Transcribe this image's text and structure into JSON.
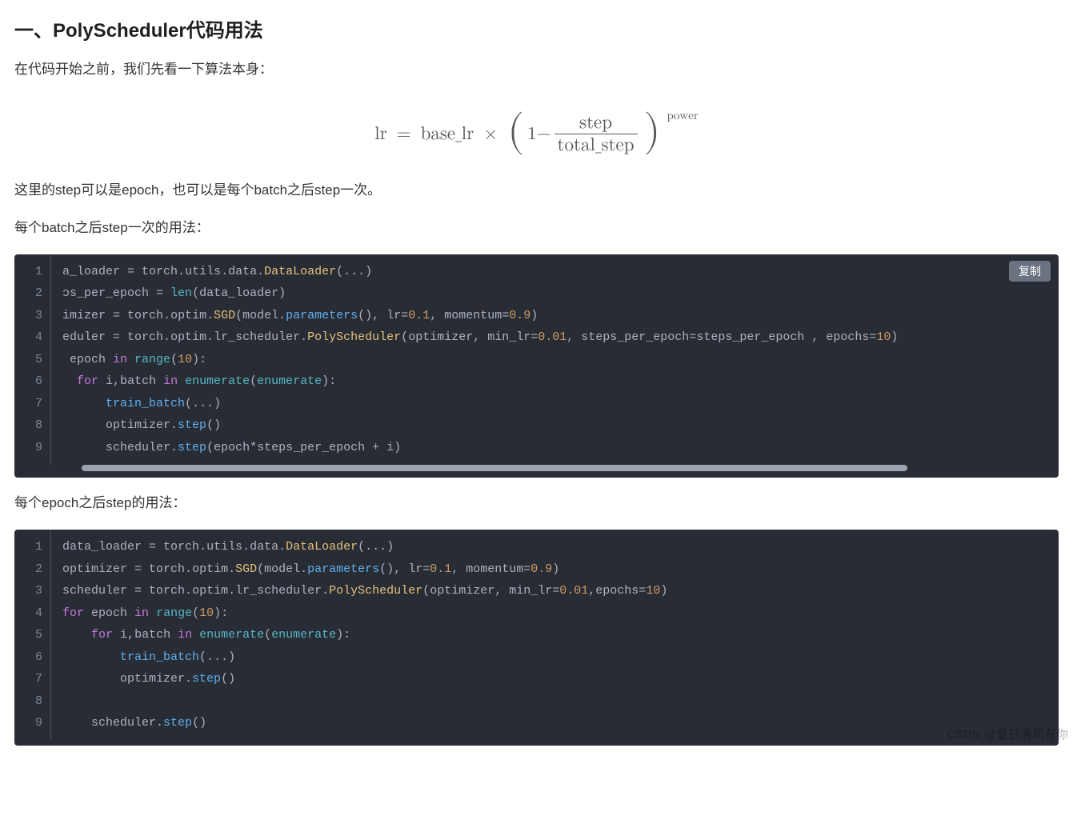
{
  "heading": "一、PolyScheduler代码用法",
  "intro": "在代码开始之前，我们先看一下算法本身：",
  "formula": {
    "lhs_lr": "lr",
    "eq": "=",
    "base_lr": "base_lr",
    "times": "×",
    "one": "1",
    "minus": "−",
    "frac_num": "step",
    "frac_den": "total_step",
    "power": "power"
  },
  "para_step_desc": "这里的step可以是epoch，也可以是每个batch之后step一次。",
  "para_batch_usage": "每个batch之后step一次的用法：",
  "copy_label": "复制",
  "code1": {
    "lines": [
      [
        [
          "id",
          "a_loader"
        ],
        [
          "op",
          " = "
        ],
        [
          "id",
          "torch"
        ],
        [
          "pun",
          "."
        ],
        [
          "id",
          "utils"
        ],
        [
          "pun",
          "."
        ],
        [
          "id",
          "data"
        ],
        [
          "pun",
          "."
        ],
        [
          "cls",
          "DataLoader"
        ],
        [
          "pun",
          "("
        ],
        [
          "pun",
          "..."
        ],
        [
          "pun",
          ")"
        ]
      ],
      [
        [
          "id",
          "ɔs_per_epoch"
        ],
        [
          "op",
          " = "
        ],
        [
          "bi",
          "len"
        ],
        [
          "pun",
          "("
        ],
        [
          "id",
          "data_loader"
        ],
        [
          "pun",
          ")"
        ]
      ],
      [
        [
          "id",
          "imizer"
        ],
        [
          "op",
          " = "
        ],
        [
          "id",
          "torch"
        ],
        [
          "pun",
          "."
        ],
        [
          "id",
          "optim"
        ],
        [
          "pun",
          "."
        ],
        [
          "cls",
          "SGD"
        ],
        [
          "pun",
          "("
        ],
        [
          "id",
          "model"
        ],
        [
          "pun",
          "."
        ],
        [
          "fn",
          "parameters"
        ],
        [
          "pun",
          "(), "
        ],
        [
          "id",
          "lr"
        ],
        [
          "op",
          "="
        ],
        [
          "num",
          "0.1"
        ],
        [
          "pun",
          ", "
        ],
        [
          "id",
          "momentum"
        ],
        [
          "op",
          "="
        ],
        [
          "num",
          "0.9"
        ],
        [
          "pun",
          ")"
        ]
      ],
      [
        [
          "id",
          "eduler"
        ],
        [
          "op",
          " = "
        ],
        [
          "id",
          "torch"
        ],
        [
          "pun",
          "."
        ],
        [
          "id",
          "optim"
        ],
        [
          "pun",
          "."
        ],
        [
          "id",
          "lr_scheduler"
        ],
        [
          "pun",
          "."
        ],
        [
          "cls",
          "PolyScheduler"
        ],
        [
          "pun",
          "("
        ],
        [
          "id",
          "optimizer"
        ],
        [
          "pun",
          ", "
        ],
        [
          "id",
          "min_lr"
        ],
        [
          "op",
          "="
        ],
        [
          "num",
          "0.01"
        ],
        [
          "pun",
          ", "
        ],
        [
          "id",
          "steps_per_epoch"
        ],
        [
          "op",
          "="
        ],
        [
          "id",
          "steps_per_epoch "
        ],
        [
          "pun",
          ", "
        ],
        [
          "id",
          "epochs"
        ],
        [
          "op",
          "="
        ],
        [
          "num",
          "10"
        ],
        [
          "pun",
          ")"
        ]
      ],
      [
        [
          "id",
          " epoch "
        ],
        [
          "kw",
          "in"
        ],
        [
          "id",
          " "
        ],
        [
          "bi",
          "range"
        ],
        [
          "pun",
          "("
        ],
        [
          "num",
          "10"
        ],
        [
          "pun",
          "):"
        ]
      ],
      [
        [
          "id",
          "  "
        ],
        [
          "kw",
          "for"
        ],
        [
          "id",
          " i"
        ],
        [
          "pun",
          ","
        ],
        [
          "id",
          "batch "
        ],
        [
          "kw",
          "in"
        ],
        [
          "id",
          " "
        ],
        [
          "bi",
          "enumerate"
        ],
        [
          "pun",
          "("
        ],
        [
          "bi",
          "enumerate"
        ],
        [
          "pun",
          "):"
        ]
      ],
      [
        [
          "id",
          "      "
        ],
        [
          "fn",
          "train_batch"
        ],
        [
          "pun",
          "("
        ],
        [
          "pun",
          "..."
        ],
        [
          "pun",
          ")"
        ]
      ],
      [
        [
          "id",
          "      optimizer"
        ],
        [
          "pun",
          "."
        ],
        [
          "fn",
          "step"
        ],
        [
          "pun",
          "()"
        ]
      ],
      [
        [
          "id",
          "      scheduler"
        ],
        [
          "pun",
          "."
        ],
        [
          "fn",
          "step"
        ],
        [
          "pun",
          "("
        ],
        [
          "id",
          "epoch"
        ],
        [
          "op",
          "*"
        ],
        [
          "id",
          "steps_per_epoch "
        ],
        [
          "op",
          "+"
        ],
        [
          "id",
          " i"
        ],
        [
          "pun",
          ")"
        ]
      ]
    ],
    "line_numbers": [
      "1",
      "2",
      "3",
      "4",
      "5",
      "6",
      "7",
      "8",
      "9"
    ]
  },
  "para_epoch_usage": "每个epoch之后step的用法：",
  "code2": {
    "lines": [
      [
        [
          "id",
          "data_loader"
        ],
        [
          "op",
          " = "
        ],
        [
          "id",
          "torch"
        ],
        [
          "pun",
          "."
        ],
        [
          "id",
          "utils"
        ],
        [
          "pun",
          "."
        ],
        [
          "id",
          "data"
        ],
        [
          "pun",
          "."
        ],
        [
          "cls",
          "DataLoader"
        ],
        [
          "pun",
          "("
        ],
        [
          "pun",
          "..."
        ],
        [
          "pun",
          ")"
        ]
      ],
      [
        [
          "id",
          "optimizer"
        ],
        [
          "op",
          " = "
        ],
        [
          "id",
          "torch"
        ],
        [
          "pun",
          "."
        ],
        [
          "id",
          "optim"
        ],
        [
          "pun",
          "."
        ],
        [
          "cls",
          "SGD"
        ],
        [
          "pun",
          "("
        ],
        [
          "id",
          "model"
        ],
        [
          "pun",
          "."
        ],
        [
          "fn",
          "parameters"
        ],
        [
          "pun",
          "(), "
        ],
        [
          "id",
          "lr"
        ],
        [
          "op",
          "="
        ],
        [
          "num",
          "0.1"
        ],
        [
          "pun",
          ", "
        ],
        [
          "id",
          "momentum"
        ],
        [
          "op",
          "="
        ],
        [
          "num",
          "0.9"
        ],
        [
          "pun",
          ")"
        ]
      ],
      [
        [
          "id",
          "scheduler"
        ],
        [
          "op",
          " = "
        ],
        [
          "id",
          "torch"
        ],
        [
          "pun",
          "."
        ],
        [
          "id",
          "optim"
        ],
        [
          "pun",
          "."
        ],
        [
          "id",
          "lr_scheduler"
        ],
        [
          "pun",
          "."
        ],
        [
          "cls",
          "PolyScheduler"
        ],
        [
          "pun",
          "("
        ],
        [
          "id",
          "optimizer"
        ],
        [
          "pun",
          ", "
        ],
        [
          "id",
          "min_lr"
        ],
        [
          "op",
          "="
        ],
        [
          "num",
          "0.01"
        ],
        [
          "pun",
          ","
        ],
        [
          "id",
          "epochs"
        ],
        [
          "op",
          "="
        ],
        [
          "num",
          "10"
        ],
        [
          "pun",
          ")"
        ]
      ],
      [
        [
          "kw",
          "for"
        ],
        [
          "id",
          " epoch "
        ],
        [
          "kw",
          "in"
        ],
        [
          "id",
          " "
        ],
        [
          "bi",
          "range"
        ],
        [
          "pun",
          "("
        ],
        [
          "num",
          "10"
        ],
        [
          "pun",
          "):"
        ]
      ],
      [
        [
          "id",
          "    "
        ],
        [
          "kw",
          "for"
        ],
        [
          "id",
          " i"
        ],
        [
          "pun",
          ","
        ],
        [
          "id",
          "batch "
        ],
        [
          "kw",
          "in"
        ],
        [
          "id",
          " "
        ],
        [
          "bi",
          "enumerate"
        ],
        [
          "pun",
          "("
        ],
        [
          "bi",
          "enumerate"
        ],
        [
          "pun",
          "):"
        ]
      ],
      [
        [
          "id",
          "        "
        ],
        [
          "fn",
          "train_batch"
        ],
        [
          "pun",
          "("
        ],
        [
          "pun",
          "..."
        ],
        [
          "pun",
          ")"
        ]
      ],
      [
        [
          "id",
          "        optimizer"
        ],
        [
          "pun",
          "."
        ],
        [
          "fn",
          "step"
        ],
        [
          "pun",
          "()"
        ]
      ],
      [
        [
          "id",
          " "
        ]
      ],
      [
        [
          "id",
          "    scheduler"
        ],
        [
          "pun",
          "."
        ],
        [
          "fn",
          "step"
        ],
        [
          "pun",
          "()"
        ]
      ]
    ],
    "line_numbers": [
      "1",
      "2",
      "3",
      "4",
      "5",
      "6",
      "7",
      "8",
      "9"
    ]
  },
  "watermark": "CSDN @夏日清风有你"
}
